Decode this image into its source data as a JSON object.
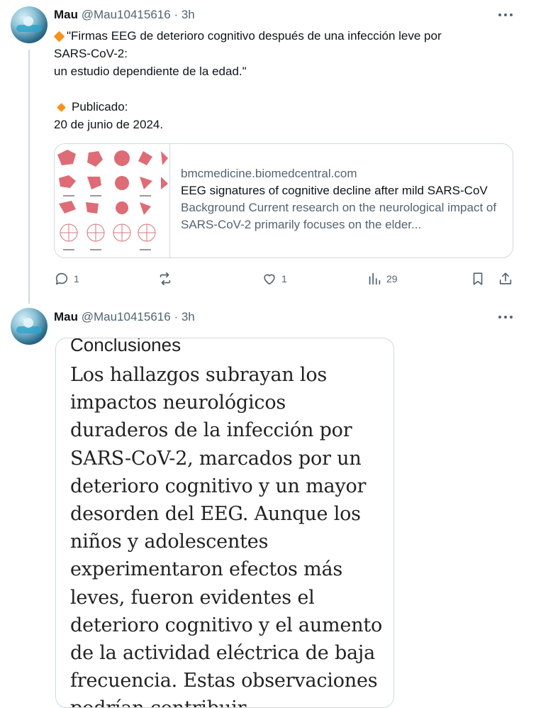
{
  "tweet1": {
    "name": "Mau",
    "handle": "@Mau10415616",
    "time": "3h",
    "lines": [
      "\"Firmas EEG de deterioro cognitivo después de una infección leve por",
      "SARS-CoV-2:",
      "un estudio dependiente de la edad.\"",
      "Publicado:",
      "20 de junio de 2024."
    ],
    "card": {
      "domain": "bmcmedicine.biomedcentral.com",
      "title": "EEG signatures of cognitive decline after mild SARS-CoV",
      "description": "Background Current research on the neurological impact of SARS-CoV-2 primarily focuses on the elder..."
    },
    "actions": {
      "replies": "1",
      "reposts": "",
      "likes": "1",
      "views": "29"
    }
  },
  "tweet2": {
    "name": "Mau",
    "handle": "@Mau10415616",
    "time": "3h",
    "image": {
      "heading": "Conclusiones",
      "text": "Los hallazgos subrayan los impactos neurológicos duraderos de la infección por SARS-CoV-2, marcados por un deterioro cognitivo y un mayor desorden del EEG. Aunque los niños y adolescentes experimentaron efectos más leves, fueron evidentes el deterioro cognitivo y el aumento de la actividad eléctrica de baja frecuencia. Estas observaciones podrían contribuir"
    }
  },
  "colors": {
    "text": "#0f1419",
    "secondary": "#536471",
    "border": "#cfd9de",
    "diamond": "#f7931e"
  }
}
